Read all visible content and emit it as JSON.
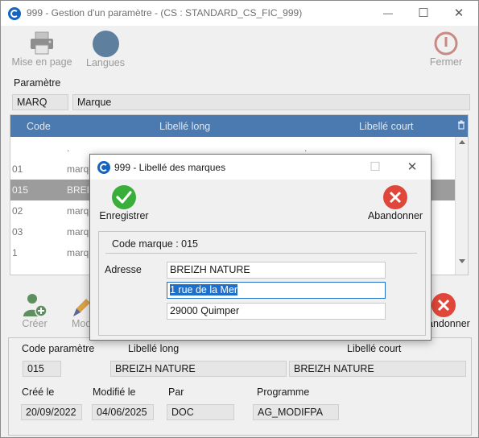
{
  "main": {
    "title": "999 - Gestion d'un paramètre - (CS : STANDARD_CS_FIC_999)",
    "window_controls": {
      "minimize": "—",
      "maximize": "☐",
      "close": "✕"
    },
    "toolbar": {
      "print_label": "Mise en page",
      "lang_label": "Langues",
      "close_label": "Fermer"
    },
    "param_label": "Paramètre",
    "param_code": "MARQ",
    "param_name": "Marque",
    "grid": {
      "headers": [
        "Code",
        "Libellé long",
        "Libellé court"
      ],
      "rows": [
        {
          "code": "",
          "long": ".",
          "short": "."
        },
        {
          "code": "01",
          "long": "marq",
          "short": ""
        },
        {
          "code": "015",
          "long": "BREI",
          "short": ""
        },
        {
          "code": "02",
          "long": "marq",
          "short": ""
        },
        {
          "code": "03",
          "long": "marq",
          "short": ""
        },
        {
          "code": "1",
          "long": "marq",
          "short": ""
        }
      ],
      "selected_row": 2
    },
    "actions": {
      "create_label": "Créer",
      "modify_label": "Mod",
      "abandon_label": "andonner"
    },
    "details": {
      "code_label": "Code paramètre",
      "long_label": "Libellé long",
      "short_label": "Libellé court",
      "code_value": "015",
      "long_value": "BREIZH NATURE",
      "short_value": "BREIZH NATURE",
      "created_label": "Créé le",
      "modified_label": "Modifié le",
      "by_label": "Par",
      "program_label": "Programme",
      "created_value": "20/09/2022",
      "modified_value": "04/06/2025",
      "by_value": "DOC",
      "program_value": "AG_MODIFPA"
    }
  },
  "dialog": {
    "title": "999 - Libellé des marques",
    "window_controls": {
      "maximize": "☐",
      "close": "✕"
    },
    "save_label": "Enregistrer",
    "abandon_label": "Abandonner",
    "code_caption": "Code marque : 015",
    "address_label": "Adresse",
    "address_lines": [
      "BREIZH NATURE",
      "1 rue de la Mer",
      "29000 Quimper"
    ]
  },
  "colors": {
    "accent": "#1f6fc9",
    "grid_header": "#4a7ab0",
    "selected_row": "#9c9c9c",
    "save_green": "#3aae3a",
    "abandon_red": "#e0473a"
  }
}
